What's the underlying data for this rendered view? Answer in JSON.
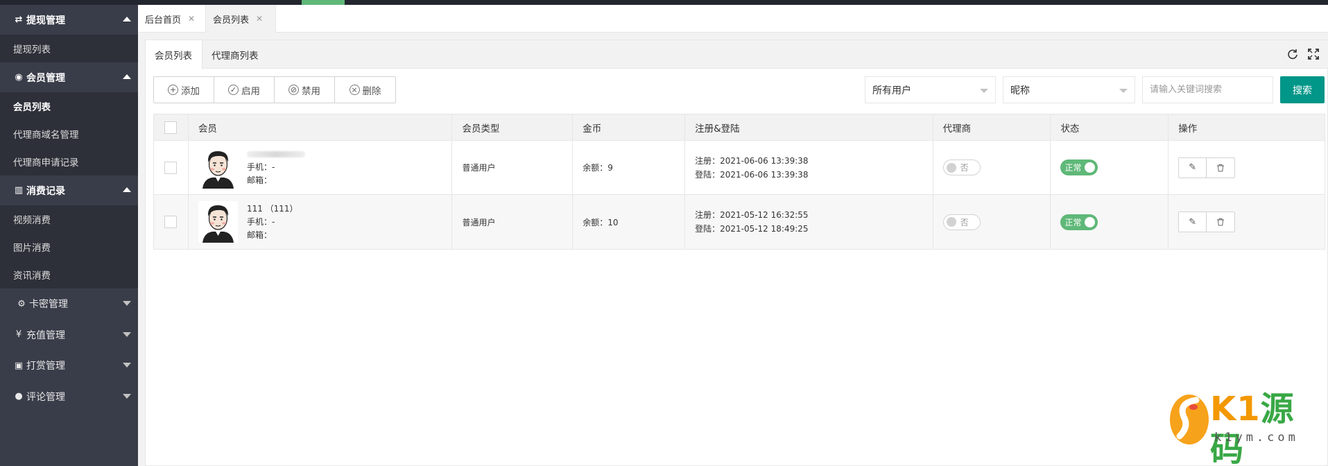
{
  "sidebar": {
    "groups": [
      {
        "icon": "⇄",
        "icon_name": "transfer-icon",
        "label": "提现管理",
        "expanded": true,
        "items": [
          "提现列表"
        ]
      },
      {
        "icon": "◉",
        "icon_name": "user-circle-icon",
        "label": "会员管理",
        "expanded": true,
        "items": [
          "会员列表",
          "代理商域名管理",
          "代理商申请记录"
        ]
      },
      {
        "icon": "▥",
        "icon_name": "bar-chart-icon",
        "label": "消费记录",
        "expanded": true,
        "items": [
          "视频消费",
          "图片消费",
          "资讯消费"
        ]
      },
      {
        "icon": "⚙",
        "icon_name": "gear-icon",
        "label": "卡密管理",
        "expanded": false,
        "items": []
      },
      {
        "icon": "¥",
        "icon_name": "yen-icon",
        "label": "充值管理",
        "expanded": false,
        "items": []
      },
      {
        "icon": "▣",
        "icon_name": "money-icon",
        "label": "打赏管理",
        "expanded": false,
        "items": []
      },
      {
        "icon": "●",
        "icon_name": "comment-icon",
        "label": "评论管理",
        "expanded": false,
        "items": []
      }
    ],
    "active_item": "会员列表"
  },
  "page_tabs": [
    {
      "label": "后台首页",
      "close": "✕"
    },
    {
      "label": "会员列表",
      "close": "✕"
    }
  ],
  "sub_tabs": [
    "会员列表",
    "代理商列表"
  ],
  "toolbar": {
    "add": "添加",
    "enable": "启用",
    "disable": "禁用",
    "delete": "删除",
    "user_filter": "所有用户",
    "field_filter": "昵称",
    "search_placeholder": "请输入关键词搜索",
    "search_button": "搜索"
  },
  "table": {
    "headers": [
      "会员",
      "会员类型",
      "金币",
      "注册&登陆",
      "代理商",
      "状态",
      "操作"
    ],
    "rows": [
      {
        "name": "",
        "phone": "手机：-",
        "email": "邮箱：",
        "type": "普通用户",
        "coins": "余额：9",
        "register": "注册：2021-06-06 13:39:38",
        "login": "登陆：2021-06-06 13:39:38",
        "agent": "否",
        "status": "正常"
      },
      {
        "name": "111 （111）",
        "phone": "手机：-",
        "email": "邮箱：",
        "type": "普通用户",
        "coins": "余额：10",
        "register": "注册：2021-05-12 16:32:55",
        "login": "登陆：2021-05-12 18:49:25",
        "agent": "否",
        "status": "正常"
      }
    ]
  },
  "watermark": {
    "brand": "K1源码",
    "brand_prefix": "K1",
    "brand_suffix": "源码",
    "url": "k1ym.com"
  },
  "colors": {
    "accent": "#009688",
    "switch_on": "#5fb878",
    "sidebar_bg": "#393d49",
    "sidebar_sub_bg": "#2d3039"
  }
}
